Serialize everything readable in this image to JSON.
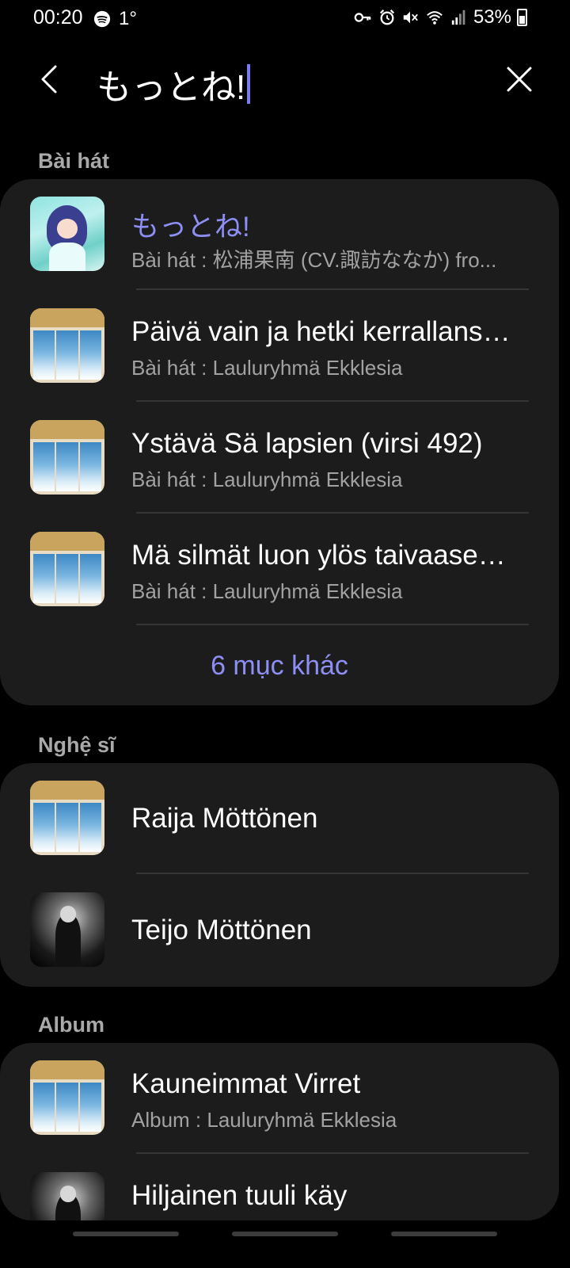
{
  "status_bar": {
    "time": "00:20",
    "temperature": "1°",
    "battery_text": "53%",
    "icons": [
      "spotify-icon",
      "key-icon",
      "alarm-icon",
      "mute-icon",
      "wifi-icon",
      "signal-icon",
      "battery-icon"
    ]
  },
  "search": {
    "query": "もっとね!",
    "back_icon": "chevron-left-icon",
    "clear_icon": "close-icon",
    "cursor_color": "#7b7cf0"
  },
  "sections": {
    "songs": {
      "title": "Bài hát",
      "items": [
        {
          "title": "もっとね!",
          "subtitle": "Bài hát : 松浦果南 (CV.諏訪ななか) fro...",
          "highlight": true
        },
        {
          "title": "Päivä vain ja hetki kerrallansa...",
          "subtitle": "Bài hát : Lauluryhmä Ekklesia"
        },
        {
          "title": "Ystävä Sä lapsien (virsi 492)",
          "subtitle": "Bài hát : Lauluryhmä Ekklesia"
        },
        {
          "title": "Mä silmät luon ylös taivaaseen...",
          "subtitle": "Bài hát : Lauluryhmä Ekklesia"
        }
      ],
      "more_label": "6 mục khác"
    },
    "artists": {
      "title": "Nghệ sĩ",
      "items": [
        {
          "title": "Raija Möttönen"
        },
        {
          "title": "Teijo Möttönen"
        }
      ]
    },
    "albums": {
      "title": "Album",
      "items": [
        {
          "title": "Kauneimmat Virret",
          "subtitle": "Album : Lauluryhmä Ekklesia"
        },
        {
          "title": "Hiljainen tuuli käy"
        }
      ]
    }
  },
  "colors": {
    "background": "#000000",
    "card": "#1c1c1c",
    "accent": "#8d8ff5",
    "secondary_text": "#a2a2a2"
  }
}
